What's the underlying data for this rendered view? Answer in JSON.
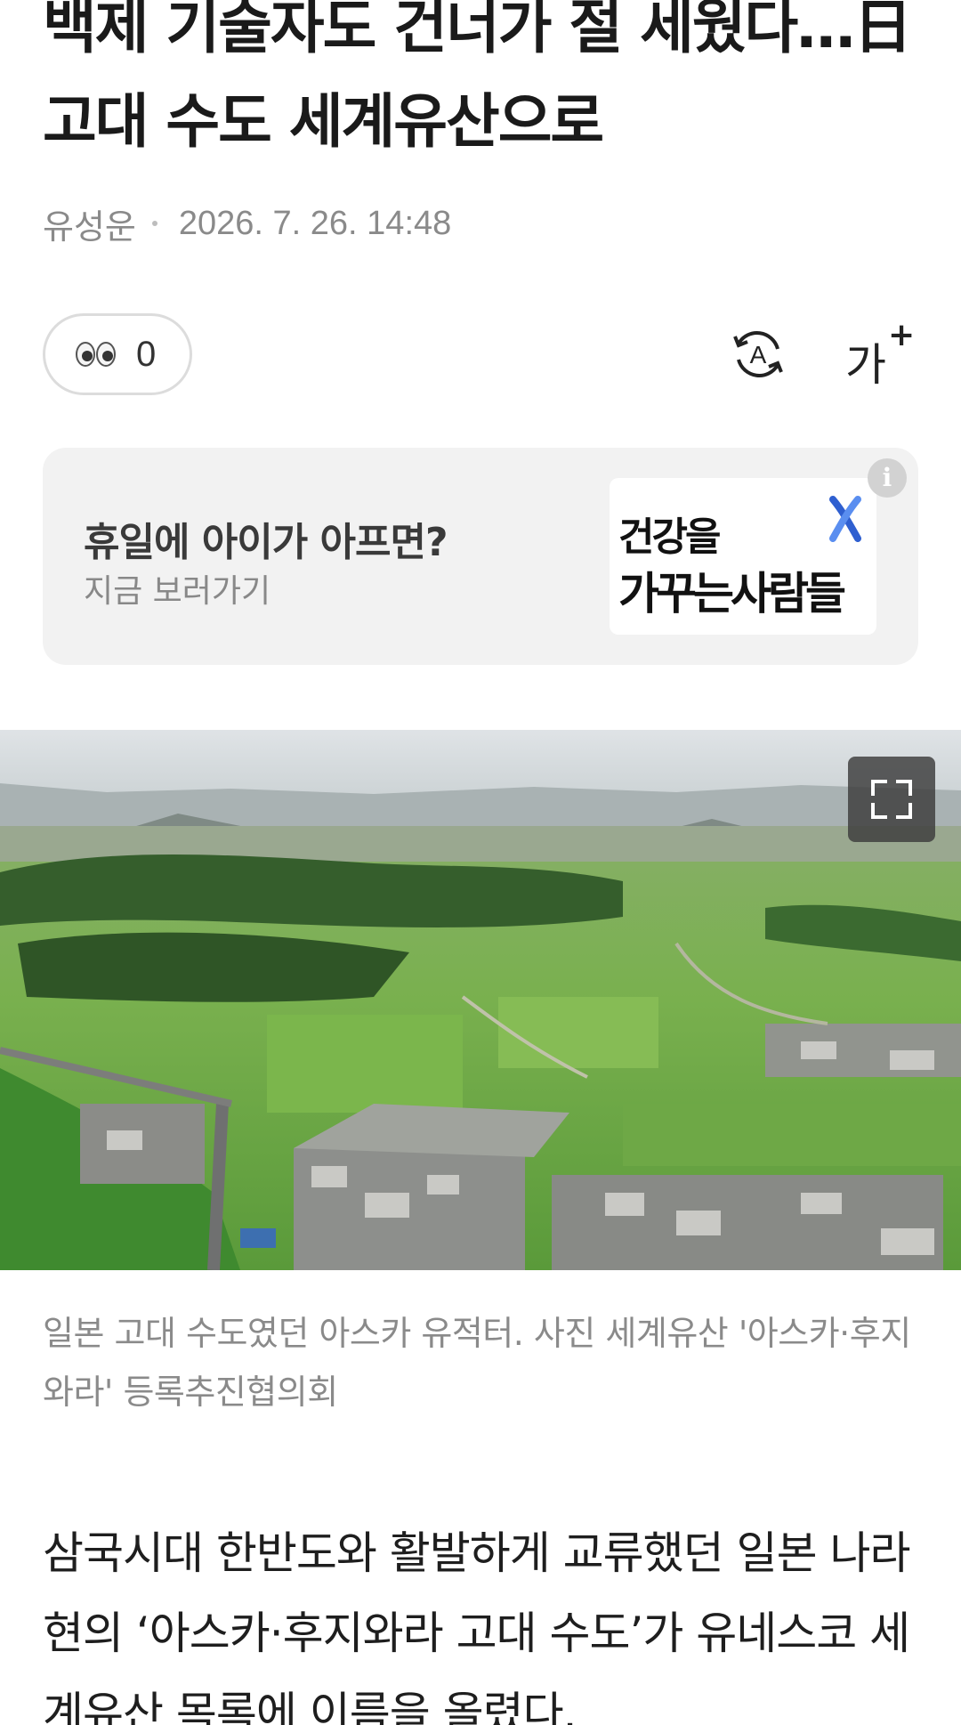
{
  "article": {
    "headline": "백제 기술자도 건너가 절 세웠다…日 고대 수도 세계유산으로",
    "author": "유성운",
    "date": "2026. 7. 26. 14:48"
  },
  "toolbar": {
    "reaction_count": "0",
    "reaction_icon": "eyes-emoji",
    "translate_icon": "translate-icon",
    "font_size_label": "가",
    "font_size_plus": "+"
  },
  "ad": {
    "title": "휴일에 아이가 아프면?",
    "subtitle": "지금 보러가기",
    "logo_line1": "건강을",
    "logo_line2": "가꾸는사람들",
    "info_label": "i",
    "accent_color": "#2f5fd0"
  },
  "photo": {
    "caption": "일본 고대 수도였던 아스카 유적터. 사진 세계유산 '아스카·후지와라' 등록추진협의회"
  },
  "body": {
    "paragraph1": "삼국시대 한반도와 활발하게 교류했던 일본 나라현의 ‘아스카·후지와라 고대 수도’가 유네스코 세계유산 목록에 이름을 올렸다."
  }
}
